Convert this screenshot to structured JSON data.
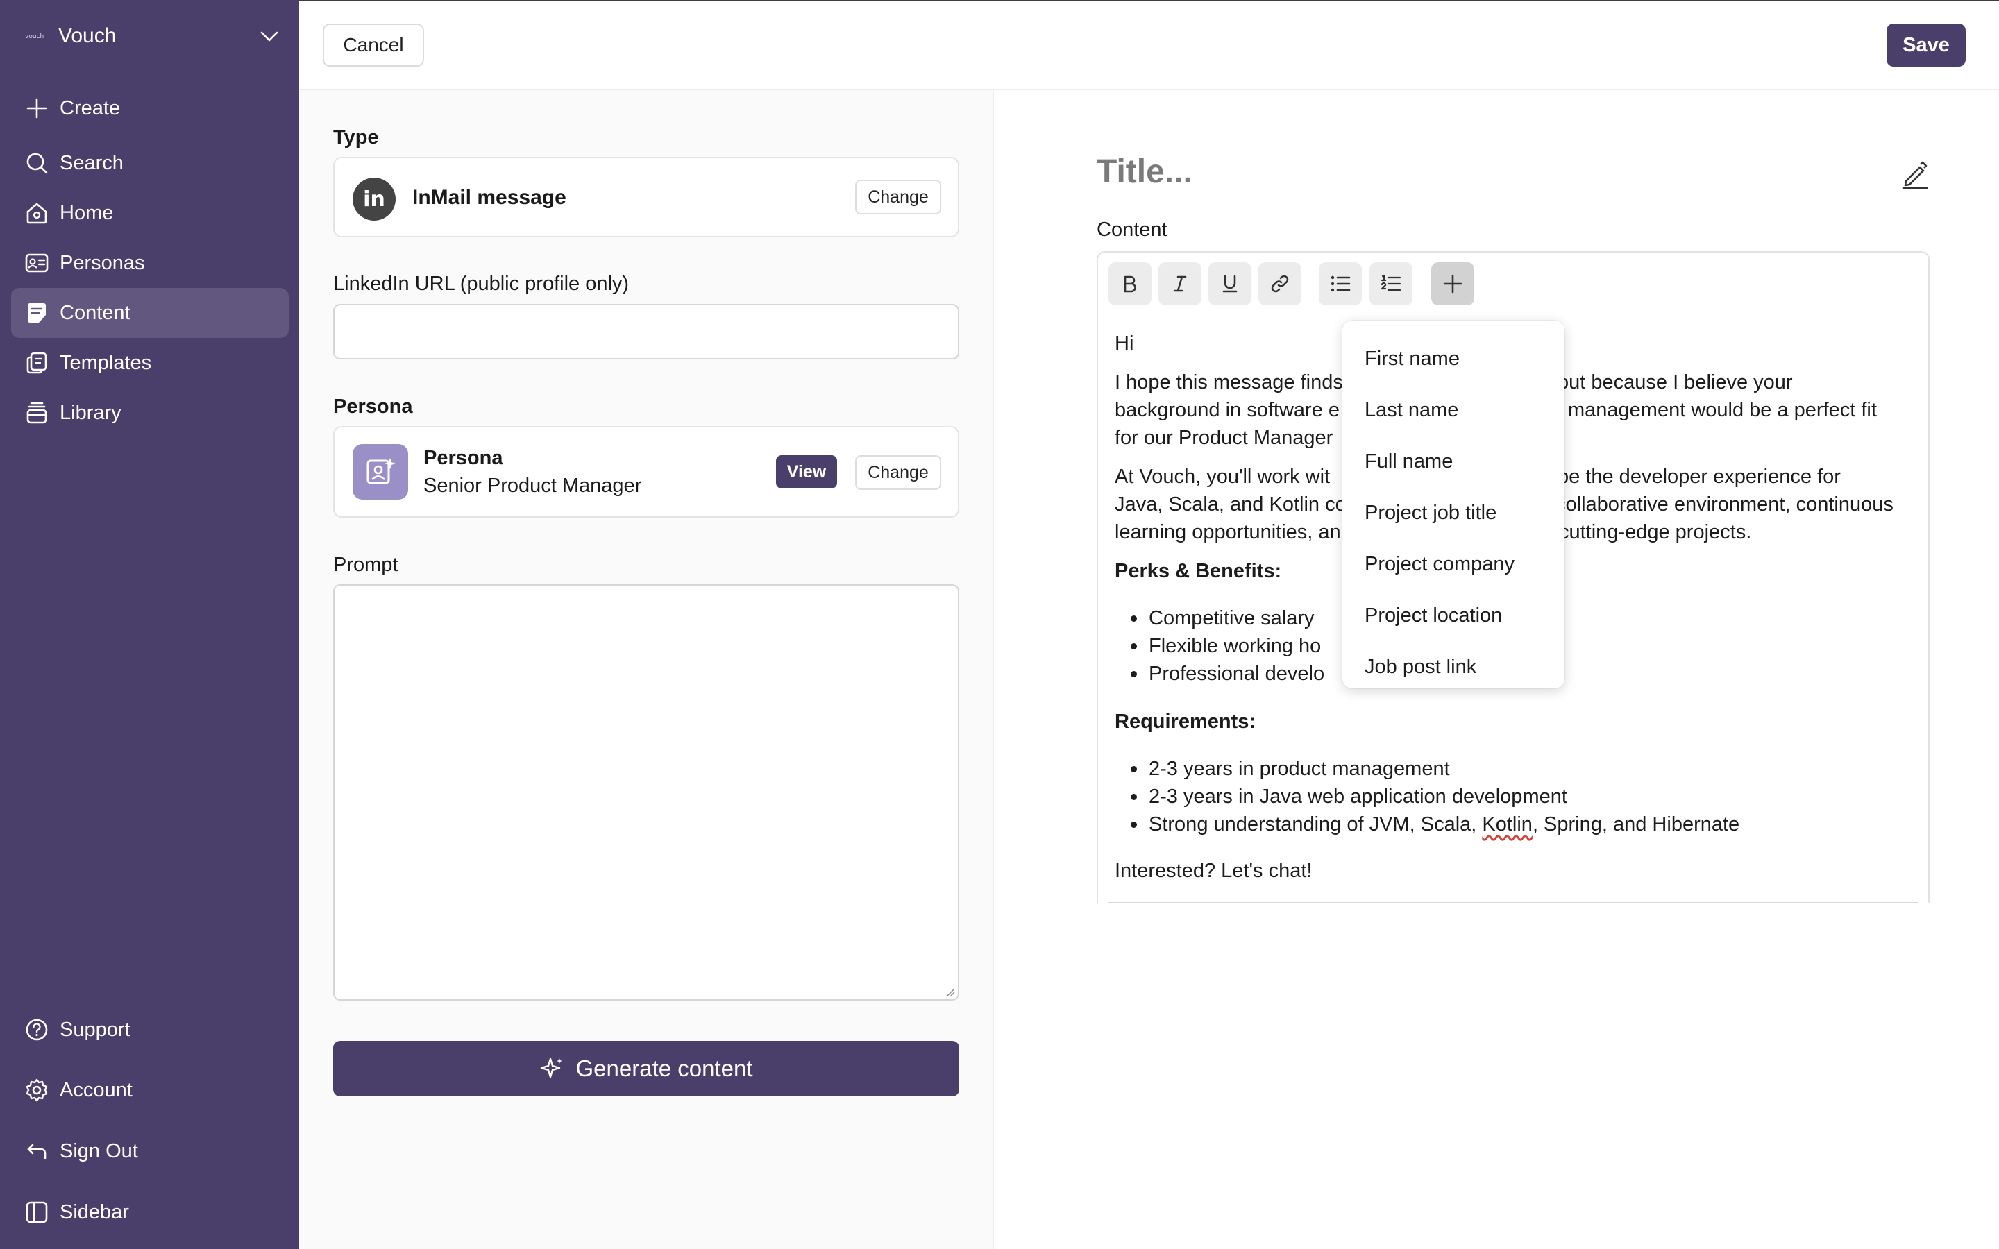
{
  "sidebar": {
    "brand": {
      "logo_text": "vouch",
      "name": "Vouch"
    },
    "nav": [
      {
        "label": "Create",
        "icon": "plus-icon"
      },
      {
        "label": "Search",
        "icon": "search-icon"
      },
      {
        "label": "Home",
        "icon": "home-icon"
      },
      {
        "label": "Personas",
        "icon": "id-card-icon"
      },
      {
        "label": "Content",
        "icon": "document-icon",
        "active": true
      },
      {
        "label": "Templates",
        "icon": "templates-icon"
      },
      {
        "label": "Library",
        "icon": "library-icon"
      }
    ],
    "footer": [
      {
        "label": "Support",
        "icon": "help-icon"
      },
      {
        "label": "Account",
        "icon": "gear-icon"
      },
      {
        "label": "Sign Out",
        "icon": "sign-out-icon"
      },
      {
        "label": "Sidebar",
        "icon": "sidebar-toggle-icon"
      }
    ]
  },
  "topbar": {
    "cancel_label": "Cancel",
    "save_label": "Save"
  },
  "form": {
    "type_label": "Type",
    "type_icon_text": "in",
    "type_value": "InMail message",
    "change_label": "Change",
    "url_label": "LinkedIn URL (public profile only)",
    "url_value": "",
    "persona_label": "Persona",
    "persona_title": "Persona",
    "persona_role": "Senior Product Manager",
    "view_label": "View",
    "prompt_label": "Prompt",
    "prompt_value": "",
    "generate_label": "Generate content"
  },
  "editor": {
    "title_placeholder": "Title...",
    "content_label": "Content",
    "toolbar": [
      {
        "name": "bold-button",
        "glyph": "B"
      },
      {
        "name": "italic-button",
        "glyph": "I"
      },
      {
        "name": "underline-button",
        "glyph": "U"
      },
      {
        "name": "link-button",
        "glyph": "link"
      },
      {
        "name": "bullet-list-button",
        "glyph": "ul"
      },
      {
        "name": "numbered-list-button",
        "glyph": "ol"
      },
      {
        "name": "insert-variable-button",
        "glyph": "+"
      }
    ],
    "greeting": "Hi",
    "para1_lines": [
      "I hope this message finds",
      "background in software e",
      "for our Product Manager"
    ],
    "para1_right_lines": [
      "out because I believe your",
      "management would be a perfect fit"
    ],
    "para2_lines": [
      "At Vouch, you'll work wit",
      "Java, Scala, and Kotlin co",
      "learning opportunities, an"
    ],
    "para2_right_lines": [
      "pe the developer experience for",
      "collaborative environment, continuous",
      "cutting-edge projects."
    ],
    "perks_heading": "Perks & Benefits:",
    "perks": [
      "Competitive salary",
      "Flexible working ho",
      "Professional develo"
    ],
    "requirements_heading": "Requirements:",
    "requirements": [
      "2-3 years in product management",
      "2-3 years in Java web application development"
    ],
    "req3_before": "Strong understanding of JVM, Scala, ",
    "req3_misspelled": "Kotlin",
    "req3_after": ", Spring, and Hibernate",
    "closing": "Interested? Let's chat!"
  },
  "variable_menu": {
    "items": [
      "First name",
      "Last name",
      "Full name",
      "Project job title",
      "Project company",
      "Project location",
      "Job post link"
    ]
  },
  "colors": {
    "sidebar_bg": "#4a3f6b",
    "sidebar_active": "#61577f",
    "primary": "#4a3f6b",
    "persona_avatar": "#9a8fc7"
  }
}
